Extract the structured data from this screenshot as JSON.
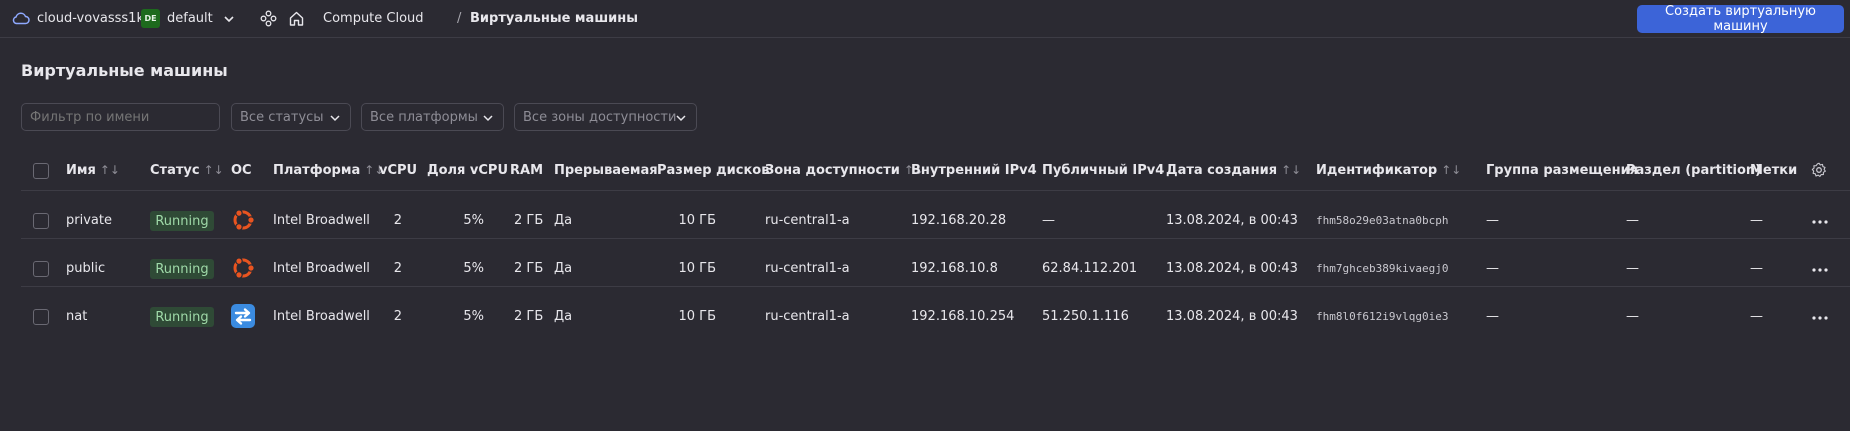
{
  "header": {
    "cloud_name": "cloud-vovasss1k",
    "folder_badge": "DE",
    "folder_name": "default",
    "breadcrumb_service": "Compute Cloud",
    "breadcrumb_separator": "/",
    "breadcrumb_current": "Виртуальные машины",
    "create_button": "Создать виртуальную машину"
  },
  "page": {
    "title": "Виртуальные машины"
  },
  "filters": {
    "name_placeholder": "Фильтр по имени",
    "status": "Все статусы",
    "platform": "Все платформы",
    "zone": "Все зоны доступности"
  },
  "columns": {
    "name": "Имя",
    "status": "Статус",
    "os": "ОС",
    "platform": "Платформа",
    "vcpu": "vCPU",
    "vcpu_share": "Доля vCPU",
    "ram": "RAM",
    "preemptible": "Прерываемая",
    "disk_size": "Размер дисков",
    "zone": "Зона доступности",
    "internal_ip": "Внутренний IPv4",
    "public_ip": "Публичный IPv4",
    "created": "Дата создания",
    "id": "Идентификатор",
    "placement_group": "Группа размещения",
    "partition": "Раздел (partition)",
    "labels": "Метки",
    "sort_glyph": "↑↓"
  },
  "rows": [
    {
      "name": "private",
      "status": "Running",
      "os_icon": "ubuntu-icon",
      "platform": "Intel Broadwell",
      "vcpu": "2",
      "vcpu_share": "5%",
      "ram": "2 ГБ",
      "preemptible": "Да",
      "disk_size": "10 ГБ",
      "zone": "ru-central1-a",
      "internal_ip": "192.168.20.28",
      "public_ip": "—",
      "created": "13.08.2024, в 00:43",
      "id": "fhm58o29e03atna0bcph",
      "placement_group": "—",
      "partition": "—",
      "labels": "—"
    },
    {
      "name": "public",
      "status": "Running",
      "os_icon": "ubuntu-icon",
      "platform": "Intel Broadwell",
      "vcpu": "2",
      "vcpu_share": "5%",
      "ram": "2 ГБ",
      "preemptible": "Да",
      "disk_size": "10 ГБ",
      "zone": "ru-central1-a",
      "internal_ip": "192.168.10.8",
      "public_ip": "62.84.112.201",
      "created": "13.08.2024, в 00:43",
      "id": "fhm7ghceb389kivaegj0",
      "placement_group": "—",
      "partition": "—",
      "labels": "—"
    },
    {
      "name": "nat",
      "status": "Running",
      "os_icon": "nat-instance-icon",
      "platform": "Intel Broadwell",
      "vcpu": "2",
      "vcpu_share": "5%",
      "ram": "2 ГБ",
      "preemptible": "Да",
      "disk_size": "10 ГБ",
      "zone": "ru-central1-a",
      "internal_ip": "192.168.10.254",
      "public_ip": "51.250.1.116",
      "created": "13.08.2024, в 00:43",
      "id": "fhm8l0f612i9vlqg0ie3",
      "placement_group": "—",
      "partition": "—",
      "labels": "—"
    }
  ],
  "colors": {
    "background": "#2b2a32",
    "accent": "#3c64d8",
    "running_bg": "#2f4a36",
    "running_text": "#9fd9a8",
    "ubuntu": "#e95420",
    "nat": "#3b8be0"
  }
}
